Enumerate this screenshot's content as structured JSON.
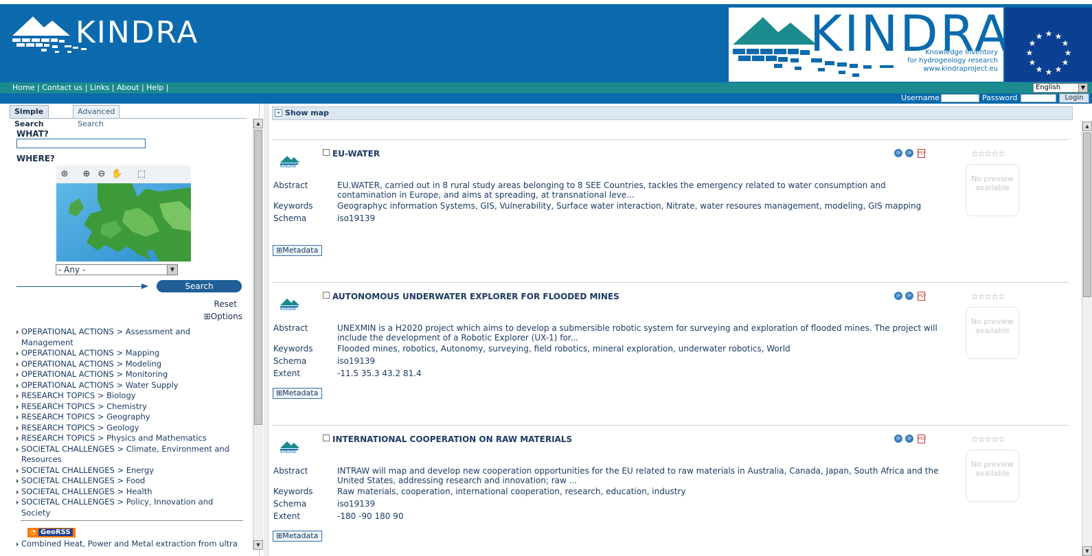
{
  "header": {
    "logo_left_text": "KINDRA",
    "logo_right_text": "KINDRA",
    "tagline_line1": "Knowledge Inventory",
    "tagline_line2": "for hydrogeology research",
    "tagline_line3": "www.kindraproject.eu"
  },
  "nav": {
    "links": [
      "Home",
      "Contact us",
      "Links",
      "About",
      "Help"
    ],
    "separator": "|",
    "language": "English"
  },
  "login": {
    "username_label": "Username",
    "password_label": "Password",
    "login_button": "Login"
  },
  "search": {
    "tabs": [
      "Simple Search",
      "Advanced Search"
    ],
    "what_label": "WHAT?",
    "where_label": "WHERE?",
    "region_selected": "- Any -",
    "search_button": "Search",
    "reset_label": "Reset",
    "options_label": "⊞Options"
  },
  "categories": [
    "OPERATIONAL ACTIONS > Assessment and Management",
    "OPERATIONAL ACTIONS > Mapping",
    "OPERATIONAL ACTIONS > Modeling",
    "OPERATIONAL ACTIONS > Monitoring",
    "OPERATIONAL ACTIONS > Water Supply",
    "RESEARCH TOPICS > Biology",
    "RESEARCH TOPICS > Chemistry",
    "RESEARCH TOPICS > Geography",
    "RESEARCH TOPICS > Geology",
    "RESEARCH TOPICS > Physics and Mathematics",
    "SOCIETAL CHALLENGES > Climate, Environment and Resources",
    "SOCIETAL CHALLENGES > Energy",
    "SOCIETAL CHALLENGES > Food",
    "SOCIETAL CHALLENGES > Health",
    "SOCIETAL CHALLENGES > Policy, Innovation and Society"
  ],
  "georss": {
    "label": "GeoRSS",
    "feed_item": "Combined Heat, Power and Metal extraction from ultra"
  },
  "results": {
    "show_map_label": "Show map",
    "labels": {
      "abstract": "Abstract",
      "keywords": "Keywords",
      "schema": "Schema",
      "extent": "Extent",
      "metadata": "Metadata",
      "no_preview_line1": "No preview",
      "no_preview_line2": "available",
      "logo_caption": "KINDRA"
    },
    "records": [
      {
        "title": "EU-WATER",
        "abstract": "EU.WATER, carried out in 8 rural study areas belonging to 8 SEE Countries, tackles the emergency related to water consumption and contamination in Europe, and aims at spreading, at transnational leve...",
        "keywords": "Geographyc information Systems, GIS, Vulnerability, Surface water interaction, Nitrate, water resoures management, modeling, GIS mapping",
        "schema": "iso19139",
        "extent": ""
      },
      {
        "title": "AUTONOMOUS UNDERWATER EXPLORER FOR FLOODED MINES",
        "abstract": "UNEXMIN is a H2020 project which aims to develop a submersible robotic system for surveying and exploration of flooded mines. The project will include the development of a Robotic Explorer (UX-1) for...",
        "keywords": "Flooded mines, robotics, Autonomy, surveying, field robotics, mineral exploration, underwater robotics, World",
        "schema": "iso19139",
        "extent": "-11.5 35.3 43.2 81.4"
      },
      {
        "title": "INTERNATIONAL COOPERATION ON RAW MATERIALS",
        "abstract": "INTRAW will map and develop new cooperation opportunities for the EU related to raw materials in Australia, Canada, Japan, South Africa and the United States, addressing research and innovation; raw ...",
        "keywords": "Raw materials, cooperation, international cooperation, research, education, industry",
        "schema": "iso19139",
        "extent": "-180 -90 180 90"
      }
    ]
  },
  "colors": {
    "header_blue": "#0a6aad",
    "nav_teal": "#1b8b8f",
    "text_navy": "#1b3a63",
    "search_button": "#1f5f96"
  }
}
